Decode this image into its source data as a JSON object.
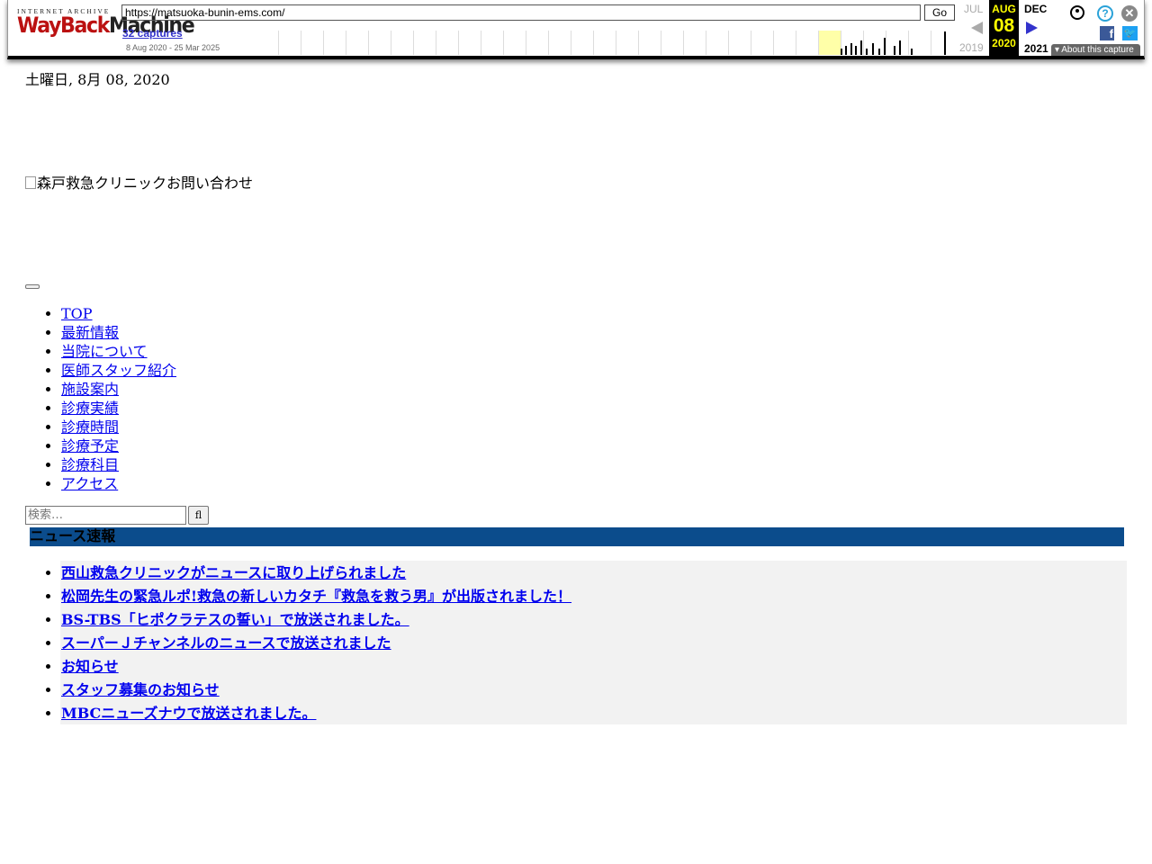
{
  "wayback": {
    "logo_top": "INTERNET ARCHIVE",
    "logo_main_a": "WayBack",
    "logo_main_b": "Machine",
    "url": "https://matsuoka-bunin-ems.com/",
    "go_label": "Go",
    "captures_label": "32 captures",
    "range_label": "8 Aug 2020 - 25 Mar 2025",
    "prev_month": "JUL",
    "prev_year": "2019",
    "current_month": "AUG",
    "current_day": "08",
    "current_year": "2020",
    "next_month": "DEC",
    "next_year": "2021",
    "about_label": "About this capture",
    "icons": [
      "user-icon",
      "help-icon",
      "close-icon",
      "facebook-icon",
      "twitter-icon",
      "prev-arrow-icon",
      "next-arrow-icon"
    ],
    "sparkline_capture_counts": [
      1,
      2,
      3,
      2,
      4,
      1,
      3,
      1,
      5,
      2,
      4,
      1,
      6
    ]
  },
  "page": {
    "date": "土曜日, 8月 08, 2020",
    "logo_alt": "森戸救急クリニックお問い合わせ",
    "nav": [
      "TOP",
      "最新情報",
      "当院について",
      "医師スタッフ紹介",
      "施設案内",
      "診療実績",
      "診療時間",
      "診療予定",
      "診療科目",
      "アクセス"
    ],
    "search_placeholder": "検索…",
    "search_button_glyph": "fl",
    "news_header": "ニュース速報",
    "news_header_color": "#0b4c8c",
    "news": [
      "西山救急クリニックがニュースに取り上げられました",
      "松岡先生の緊急ルポ!救急の新しいカタチ『救急を救う男』が出版されました！",
      "BS-TBS「ヒポクラテスの誓い」で放送されました。",
      "スーパーＪチャンネルのニュースで放送されました",
      "お知らせ",
      "スタッフ募集のお知らせ",
      "MBCニューズナウで放送されました。"
    ]
  }
}
